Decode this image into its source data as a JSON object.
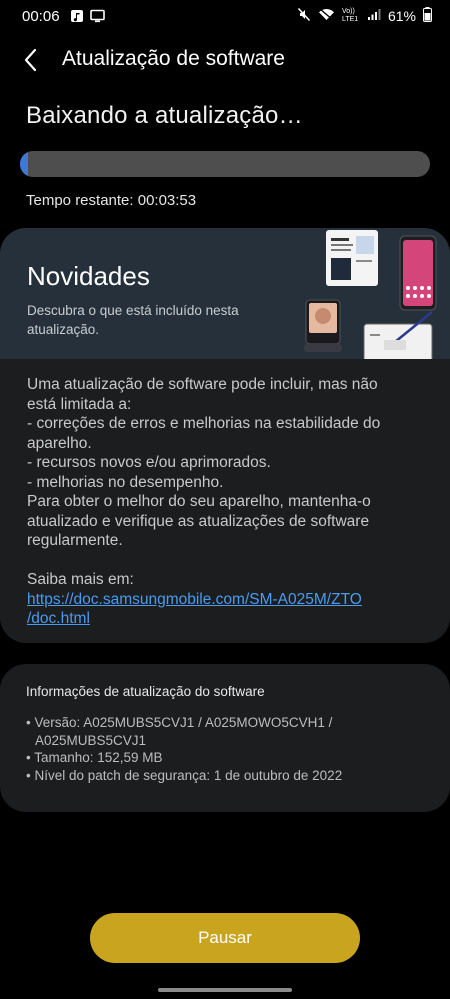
{
  "status_bar": {
    "time": "00:06",
    "network_label": "Vo)) LTE1",
    "battery": "61%"
  },
  "header": {
    "title": "Atualização de software"
  },
  "download": {
    "heading": "Baixando a atualização…",
    "progress_fraction": 0.02,
    "remaining": "Tempo restante: 00:03:53"
  },
  "news": {
    "title": "Novidades",
    "subtitle_lines": [
      "Descubra o que está incluído nesta",
      "atualização."
    ],
    "body_lines": [
      "Uma atualização de software pode incluir, mas não",
      "está limitada a:",
      " - correções de erros e melhorias na estabilidade do",
      "aparelho.",
      " - recursos novos e/ou aprimorados.",
      " - melhorias no desempenho.",
      "Para obter o melhor do seu aparelho, mantenha-o",
      "atualizado e verifique as atualizações de software",
      "regularmente.",
      "",
      "Saiba mais em:"
    ],
    "link_lines": [
      "https://doc.samsungmobile.com/SM-A025M/ZTO",
      "/doc.html"
    ]
  },
  "info": {
    "title": "Informações de atualização do software",
    "lines": [
      "• Versão: A025MUBS5CVJ1 / A025MOWO5CVH1 /",
      "  A025MUBS5CVJ1",
      "• Tamanho: 152,59 MB",
      "• Nível do patch de segurança: 1 de outubro de 2022"
    ]
  },
  "actions": {
    "pause_label": "Pausar"
  },
  "colors": {
    "progress": "#3d7ad8",
    "button": "#c9a51f",
    "link": "#4b9bf0"
  }
}
